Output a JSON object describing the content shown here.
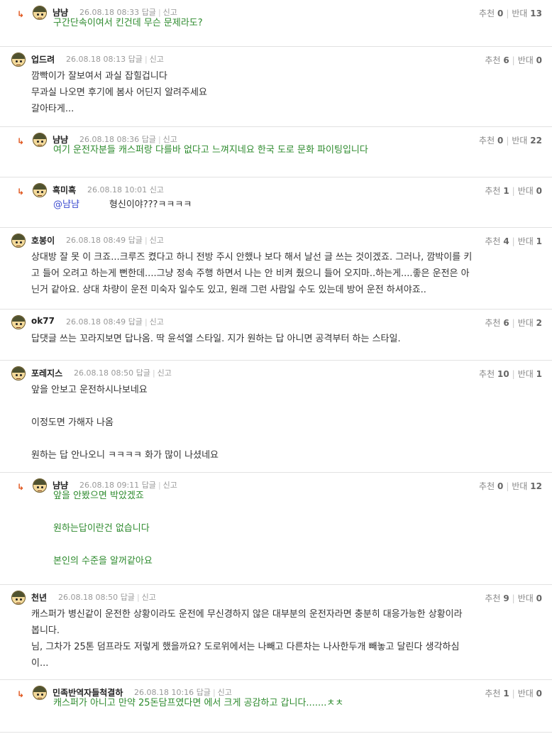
{
  "labels": {
    "reply": "답글",
    "report": "신고",
    "up": "추천",
    "down": "반대"
  },
  "comments": [
    {
      "nick": "냠냠",
      "date": "26.08.18 08:33",
      "up": "0",
      "down": "13",
      "lines": [
        "구간단속이여서 킨건데 무슨 문제라도?"
      ]
    },
    {
      "nick": "업드려",
      "date": "26.08.18 08:13",
      "up": "6",
      "down": "0",
      "lines": [
        "깜빡이가 잘보여서 과실 잡힐겁니다",
        "무과실 나오면 후기에 봄사 어딘지 알려주세요",
        "갈아타게..."
      ]
    },
    {
      "nick": "냠냠",
      "date": "26.08.18 08:36",
      "up": "0",
      "down": "22",
      "lines": [
        "여기 운전자분들 캐스퍼랑 다를바 없다고 느껴지네요 한국 도로 문화 파이팅입니다"
      ]
    },
    {
      "nick": "흑미흑",
      "date": "26.08.18 10:01",
      "up": "1",
      "down": "0",
      "mention": "@냠냠",
      "lines": [
        "형신이야???ㅋㅋㅋㅋ"
      ]
    },
    {
      "nick": "호봉이",
      "date": "26.08.18 08:49",
      "up": "4",
      "down": "1",
      "lines": [
        "상대방 잘 못 이 크죠...크루즈 켰다고 하니 전방 주시 안했나 보다 해서 날선 글 쓰는 것이겠죠. 그러나, 깜박이를 키",
        "고 들어 오려고 하는게 뻔한데....그냥 정속 주행 하면서 나는 안 비켜 줬으니 들어 오지마..하는게....좋은 운전은 아",
        "닌거 같아요. 상대 차량이 운전 미숙자 일수도 있고, 원래 그런 사람일 수도 있는데 방어 운전 하셔야죠.."
      ]
    },
    {
      "nick": "ok77",
      "date": "26.08.18 08:49",
      "up": "6",
      "down": "2",
      "lines": [
        "답댓글 쓰는 꼬라지보면 답나옴. 딱 윤석열 스타일. 지가 원하는 답 아니면 공격부터 하는 스타일."
      ]
    },
    {
      "nick": "포레지스",
      "date": "26.08.18 08:50",
      "up": "10",
      "down": "1",
      "lines": [
        "앞을 안보고 운전하시나보네요",
        "",
        "이정도면 가해자 나옴",
        "",
        "원하는 답 안나오니 ㅋㅋㅋㅋ 화가 많이 나셨네요"
      ]
    },
    {
      "nick": "냠냠",
      "date": "26.08.18 09:11",
      "up": "0",
      "down": "12",
      "lines": [
        "앞을 안봤으면 박았겠죠",
        "",
        "원하는답이란건 없습니다",
        "",
        "본인의 수준을 알꺼같아요"
      ]
    },
    {
      "nick": "천년",
      "date": "26.08.18 08:50",
      "up": "9",
      "down": "0",
      "lines": [
        "캐스퍼가 병신같이 운전한 상황이라도 운전에 무신경하지 않은 대부분의 운전자라면 충분히 대응가능한 상황이라",
        "봅니다.",
        "님, 그차가 25톤 덤프라도 저렇게 했을까요? 도로위에서는 나빼고 다른차는 나사한두개 빼놓고 달린다 생각하심",
        "이..."
      ]
    },
    {
      "nick": "민족반역자들척결하",
      "date": "26.08.18 10:16",
      "up": "1",
      "down": "0",
      "lines": [
        "캐스퍼가 아니고 만약 25돈담프였다면 에서 크게 공감하고 갑니다.......ㅊㅊ"
      ]
    }
  ]
}
